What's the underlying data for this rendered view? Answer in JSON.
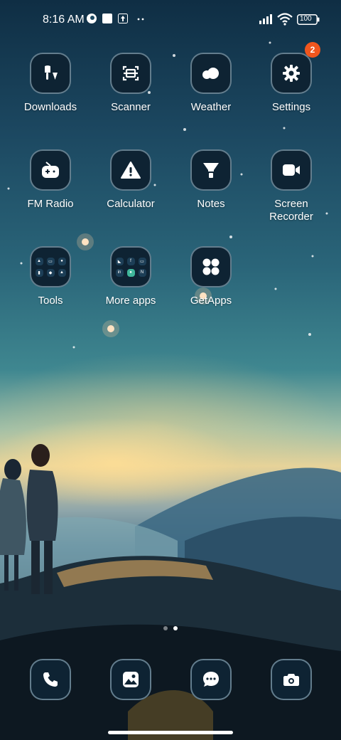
{
  "status_bar": {
    "time": "8:16 AM",
    "battery": "100",
    "icons": [
      "notification-icon",
      "square-icon",
      "upload-icon",
      "more-dots-icon",
      "signal-icon",
      "wifi-icon",
      "battery-icon"
    ]
  },
  "apps": [
    {
      "label": "Downloads",
      "icon": "download-icon"
    },
    {
      "label": "Scanner",
      "icon": "scanner-icon"
    },
    {
      "label": "Weather",
      "icon": "cloud-icon"
    },
    {
      "label": "Settings",
      "icon": "gear-icon",
      "badge": "2"
    },
    {
      "label": "FM Radio",
      "icon": "radio-icon"
    },
    {
      "label": "Calculator",
      "icon": "calculator-icon"
    },
    {
      "label": "Notes",
      "icon": "notes-icon"
    },
    {
      "label": "Screen\nRecorder",
      "icon": "video-icon"
    },
    {
      "label": "Tools",
      "icon": "folder-icon"
    },
    {
      "label": "More apps",
      "icon": "folder-icon"
    },
    {
      "label": "GetApps",
      "icon": "getapps-icon"
    }
  ],
  "dock": [
    {
      "name": "phone",
      "icon": "phone-icon"
    },
    {
      "name": "gallery",
      "icon": "gallery-icon"
    },
    {
      "name": "messages",
      "icon": "message-icon"
    },
    {
      "name": "camera",
      "icon": "camera-icon"
    }
  ],
  "pager": {
    "pages": 2,
    "active": 2
  },
  "colors": {
    "badge": "#f0561e",
    "tile": "#0e2333"
  }
}
